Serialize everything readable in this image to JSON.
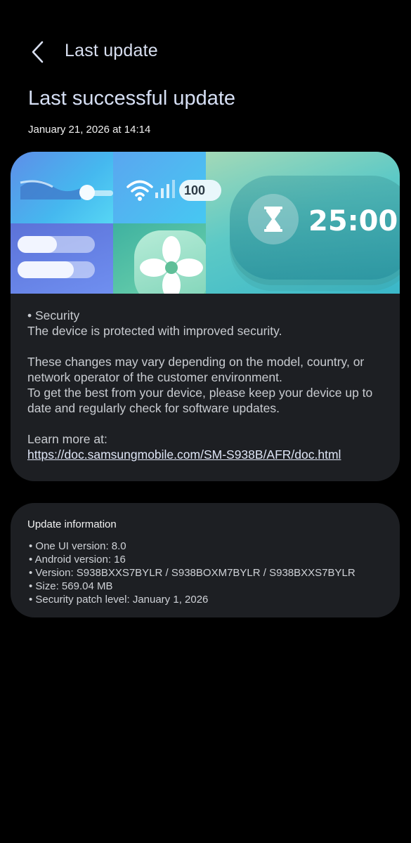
{
  "header": {
    "title": "Last update",
    "back_icon": "chevron-left-icon"
  },
  "page": {
    "title": "Last successful update",
    "date": "January 21, 2026 at 14:14"
  },
  "banner": {
    "timer": "25:00",
    "battery_percent_text": "100",
    "icons": [
      "wave-slider-icon",
      "wifi-icon",
      "signal-icon",
      "hourglass-icon",
      "fan-icon"
    ]
  },
  "notes": {
    "section": "• Security",
    "section_desc": "The device is protected with improved security.",
    "disclaimer": "These changes may vary depending on the model, country, or network operator of the customer environment.",
    "advice": "To get the best from your device, please keep your device up to date and regularly check for software updates.",
    "learn_more": "Learn more at:",
    "link": "https://doc.samsungmobile.com/SM-S938B/AFR/doc.html"
  },
  "info": {
    "title": "Update information",
    "items": [
      "• One UI version: 8.0",
      "• Android version: 16",
      "• Version: S938BXXS7BYLR / S938BOXM7BYLR / S938BXXS7BYLR",
      "• Size: 569.04 MB",
      "• Security patch level: January 1, 2026"
    ]
  },
  "colors": {
    "background": "#000000",
    "card": "#1d1f23",
    "title": "#d6dff4"
  }
}
